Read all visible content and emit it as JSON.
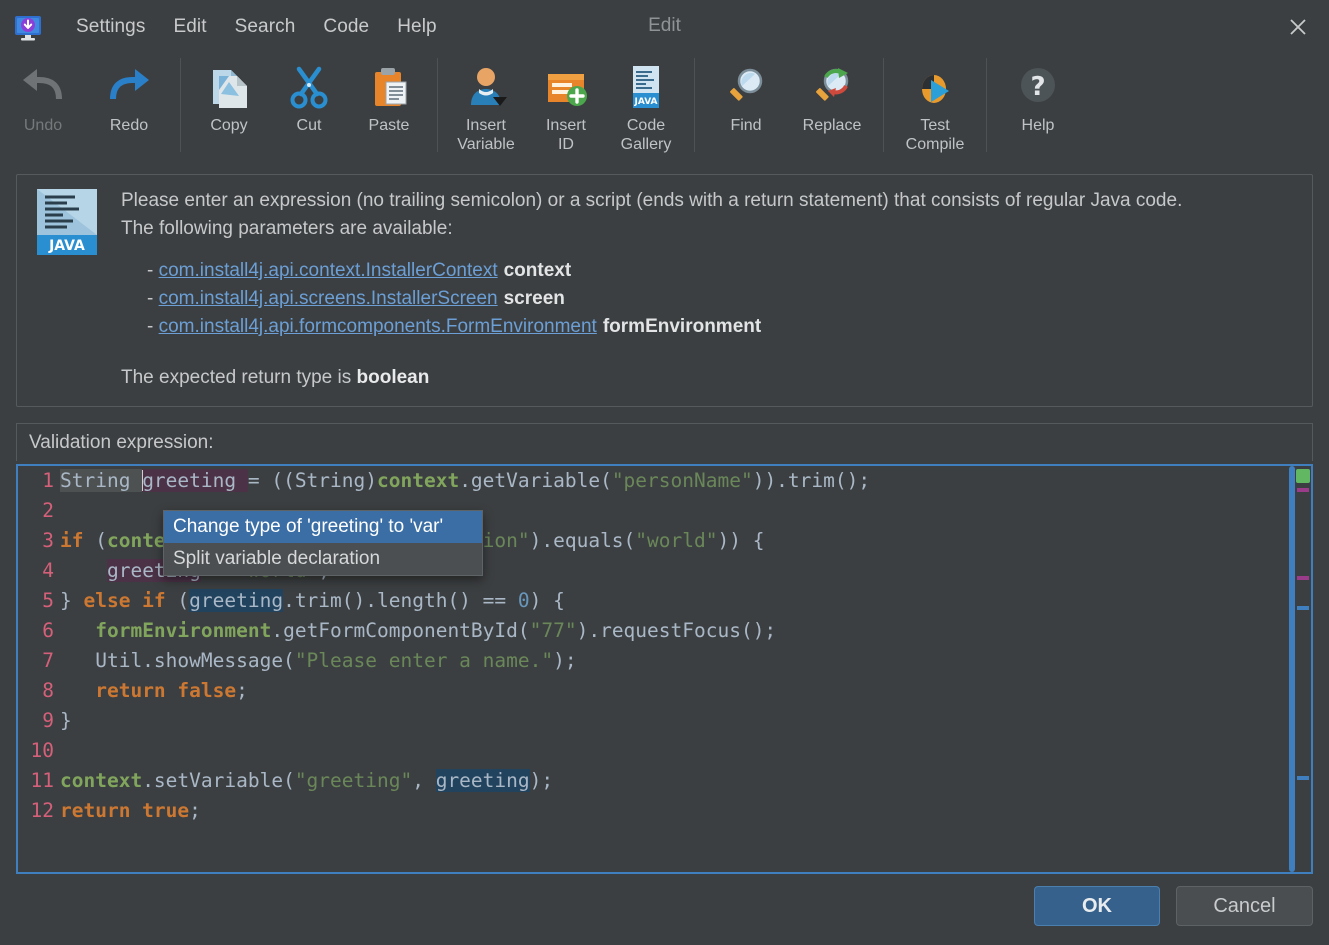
{
  "window": {
    "title": "Edit",
    "app_icon": "install4j-monitor-icon",
    "close_icon": "close-icon"
  },
  "menubar": {
    "items": [
      {
        "label": "Settings",
        "name": "menu-settings"
      },
      {
        "label": "Edit",
        "name": "menu-edit"
      },
      {
        "label": "Search",
        "name": "menu-search"
      },
      {
        "label": "Code",
        "name": "menu-code"
      },
      {
        "label": "Help",
        "name": "menu-help"
      }
    ]
  },
  "toolbar": {
    "groups": [
      {
        "buttons": [
          {
            "label": "Undo",
            "icon": "undo-arrow-icon",
            "disabled": true
          },
          {
            "label": "Redo",
            "icon": "redo-arrow-icon",
            "disabled": false
          }
        ]
      },
      {
        "buttons": [
          {
            "label": "Copy",
            "icon": "copy-pages-icon",
            "disabled": false
          },
          {
            "label": "Cut",
            "icon": "scissors-icon",
            "disabled": false
          },
          {
            "label": "Paste",
            "icon": "clipboard-paste-icon",
            "disabled": false
          }
        ]
      },
      {
        "buttons": [
          {
            "label": "Insert\nVariable",
            "icon": "user-avatar-icon",
            "disabled": false
          },
          {
            "label": "Insert\nID",
            "icon": "insert-id-plus-icon",
            "disabled": false
          },
          {
            "label": "Code\nGallery",
            "icon": "java-document-icon",
            "disabled": false
          }
        ]
      },
      {
        "buttons": [
          {
            "label": "Find",
            "icon": "magnifier-icon",
            "disabled": false
          },
          {
            "label": "Replace",
            "icon": "magnifier-replace-icon",
            "disabled": false
          }
        ]
      },
      {
        "buttons": [
          {
            "label": "Test\nCompile",
            "icon": "bug-play-icon",
            "disabled": false
          }
        ]
      },
      {
        "buttons": [
          {
            "label": "Help",
            "icon": "question-mark-icon",
            "disabled": false
          }
        ]
      }
    ]
  },
  "info_panel": {
    "icon": "java-file-icon",
    "icon_badge": "JAVA",
    "paragraph_line1": "Please enter an expression (no trailing semicolon) or a script (ends with a return statement) that consists of regular Java code.",
    "paragraph_line2": "The following parameters are available:",
    "parameters": [
      {
        "type": "com.install4j.api.context.InstallerContext",
        "name": "context"
      },
      {
        "type": "com.install4j.api.screens.InstallerScreen",
        "name": "screen"
      },
      {
        "type": "com.install4j.api.formcomponents.FormEnvironment",
        "name": "formEnvironment"
      }
    ],
    "return_prefix": "The expected return type is ",
    "return_type": "boolean"
  },
  "editor": {
    "field_label": "Validation expression:",
    "lines": [
      {
        "no": "1",
        "text": "String greeting = ((String)context.getVariable(\"personName\")).trim();"
      },
      {
        "no": "2",
        "text": ""
      },
      {
        "no": "3",
        "text": "if (context.getVariable(\"greetingOption\").equals(\"world\")) {"
      },
      {
        "no": "4",
        "text": "    greeting = \"world\";"
      },
      {
        "no": "5",
        "text": "} else if (greeting.trim().length() == 0) {"
      },
      {
        "no": "6",
        "text": "    formEnvironment.getFormComponentById(\"77\").requestFocus();"
      },
      {
        "no": "7",
        "text": "    Util.showMessage(\"Please enter a name.\");"
      },
      {
        "no": "8",
        "text": "    return false;"
      },
      {
        "no": "9",
        "text": "}"
      },
      {
        "no": "10",
        "text": ""
      },
      {
        "no": "11",
        "text": "context.setVariable(\"greeting\", greeting);"
      },
      {
        "no": "12",
        "text": "return true;"
      }
    ],
    "status_square_color": "#62b862",
    "marker_colors": {
      "occurrence": "#9b3c8a",
      "caret_row": "#3f7fbf"
    }
  },
  "context_menu": {
    "items": [
      {
        "label": "Change type of 'greeting' to 'var'",
        "selected": true
      },
      {
        "label": "Split variable declaration",
        "selected": false
      }
    ]
  },
  "footer": {
    "ok_label": "OK",
    "cancel_label": "Cancel"
  },
  "colors": {
    "accent": "#3f7fbf",
    "panel_bg": "#3c3f41",
    "link": "#6b9fd6",
    "selection": "#3a6ea5"
  }
}
